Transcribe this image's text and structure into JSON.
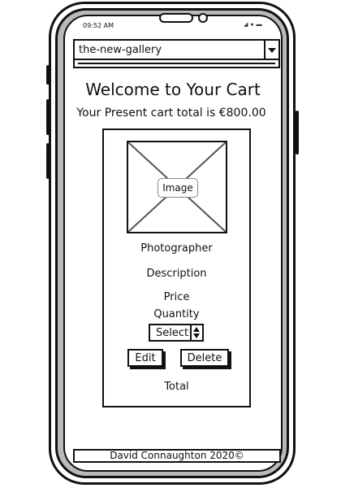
{
  "status_bar": {
    "time": "09:52 AM",
    "icons": [
      "signal-icon",
      "wifi-icon",
      "battery-icon"
    ]
  },
  "header": {
    "site_select_value": "the-new-gallery"
  },
  "main": {
    "title": "Welcome to Your Cart",
    "cart_total_text": "Your Present cart total is €800.00"
  },
  "cart_item": {
    "image_label": "Image",
    "photographer": "Photographer",
    "description": "Description",
    "price": "Price",
    "quantity_label": "Quantity",
    "quantity_select_value": "Select",
    "edit_label": "Edit",
    "delete_label": "Delete",
    "total_label": "Total"
  },
  "footer": {
    "text": "David Connaughton 2020©"
  }
}
